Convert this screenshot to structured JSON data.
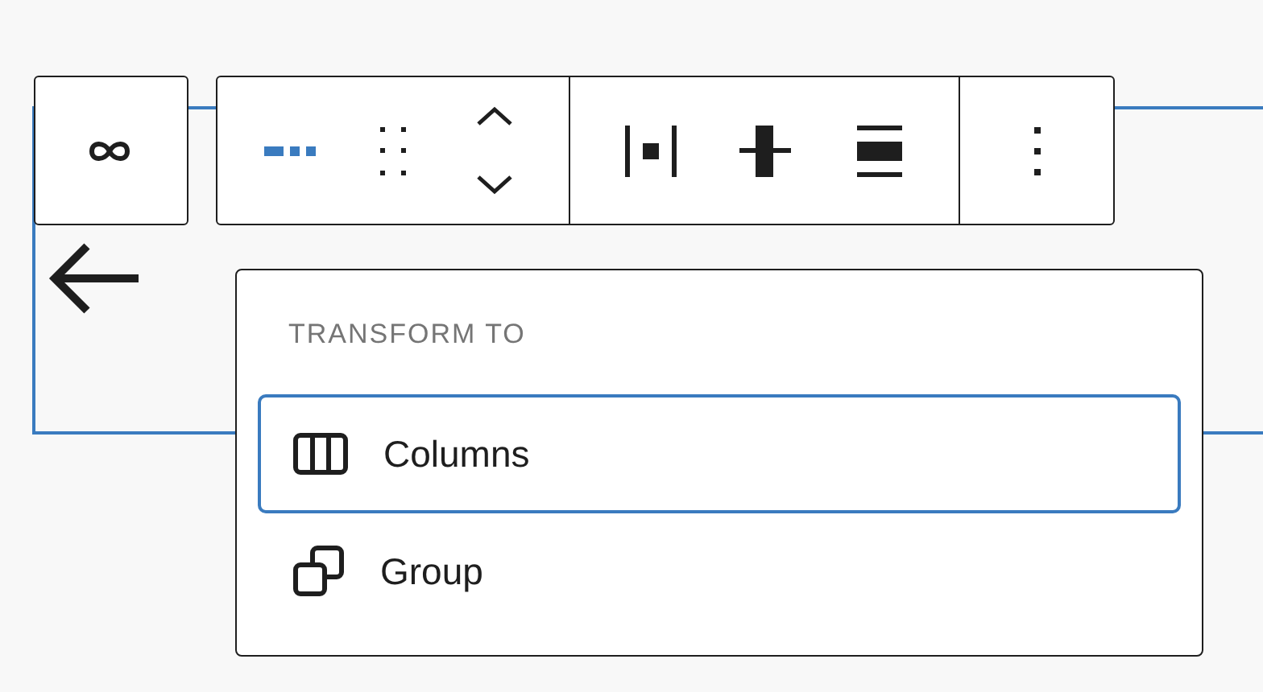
{
  "transform_menu": {
    "heading": "TRANSFORM TO",
    "items": [
      {
        "label": "Columns",
        "kind": "columns",
        "selected": true
      },
      {
        "label": "Group",
        "kind": "group",
        "selected": false
      }
    ]
  }
}
